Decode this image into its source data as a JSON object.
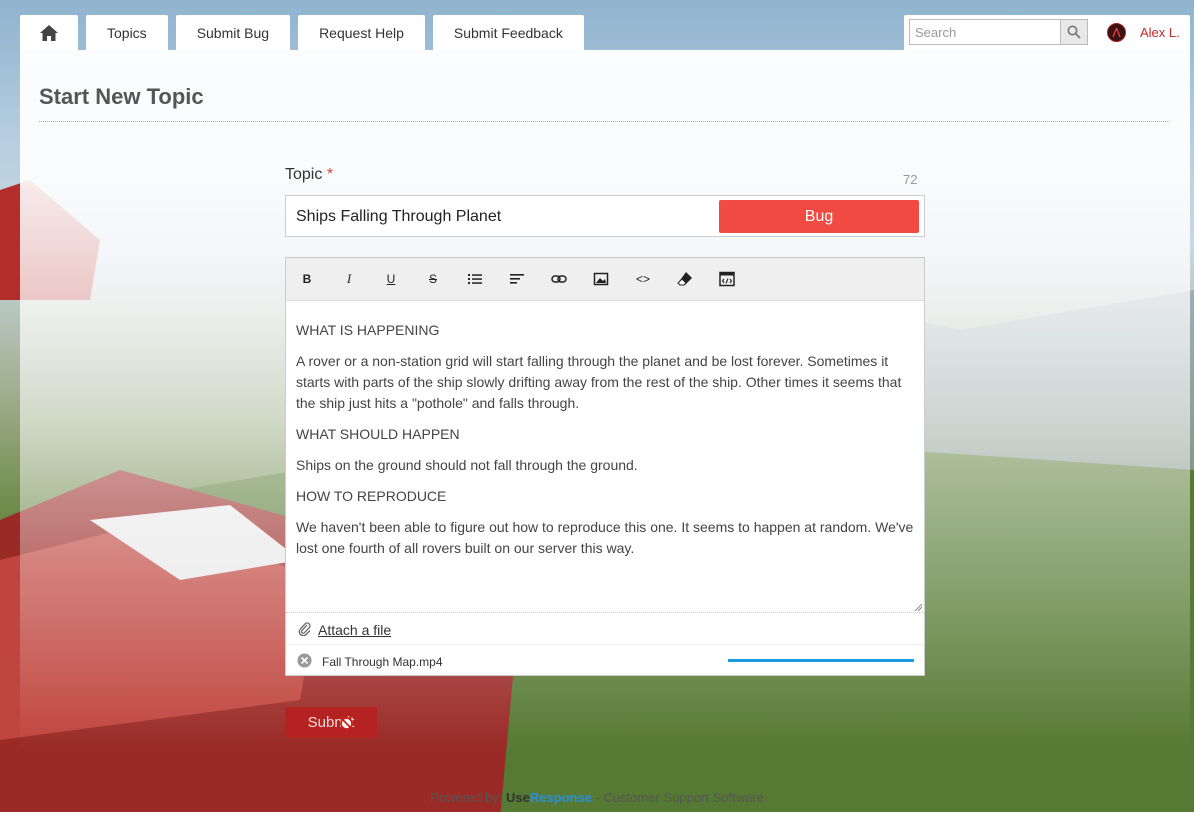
{
  "nav": {
    "home_icon": "home-icon",
    "tabs": [
      {
        "label": "Topics"
      },
      {
        "label": "Submit Bug"
      },
      {
        "label": "Request Help"
      },
      {
        "label": "Submit Feedback"
      }
    ]
  },
  "search": {
    "placeholder": "Search",
    "icon": "search-icon"
  },
  "user": {
    "name": "Alex L.",
    "avatar_icon": "avatar"
  },
  "page": {
    "title": "Start New Topic"
  },
  "form": {
    "topic_label": "Topic",
    "required_mark": "*",
    "char_count": "72",
    "topic_value": "Ships Falling Through Planet",
    "type_badge": "Bug",
    "type_color": "#f14a42",
    "toolbar": [
      {
        "name": "bold",
        "glyph": "B"
      },
      {
        "name": "italic",
        "glyph": "I"
      },
      {
        "name": "underline",
        "glyph": "U"
      },
      {
        "name": "strikethrough",
        "glyph": "S"
      },
      {
        "name": "bulleted-list",
        "glyph": ""
      },
      {
        "name": "align-left",
        "glyph": ""
      },
      {
        "name": "link",
        "glyph": ""
      },
      {
        "name": "image",
        "glyph": ""
      },
      {
        "name": "code",
        "glyph": "<>"
      },
      {
        "name": "clear-formatting",
        "glyph": ""
      },
      {
        "name": "html-source",
        "glyph": ""
      }
    ],
    "body": {
      "h1": "WHAT IS HAPPENING",
      "p1": "A rover or a non-station grid will start falling through the planet and be lost forever. Sometimes it starts with parts of the ship slowly drifting away from the rest of the ship. Other times it seems that the ship just hits a \"pothole\" and falls through.",
      "h2": "WHAT SHOULD HAPPEN",
      "p2": "Ships on the ground should not fall through the ground.",
      "h3": "HOW TO REPRODUCE",
      "p3": "We haven't been able to figure out how to reproduce this one. It seems to happen at random. We've lost one fourth of all rovers built on our server this way."
    },
    "attach_label": "Attach a file",
    "attachment": {
      "file_name": "Fall Through Map.mp4",
      "upload_progress": 1.0
    },
    "submit_label": "Submit",
    "submit_color": "#b52222"
  },
  "footer": {
    "prefix": "Powered by: ",
    "brand_a": "Use",
    "brand_b": "Response",
    "suffix": " - Customer Support Software"
  }
}
